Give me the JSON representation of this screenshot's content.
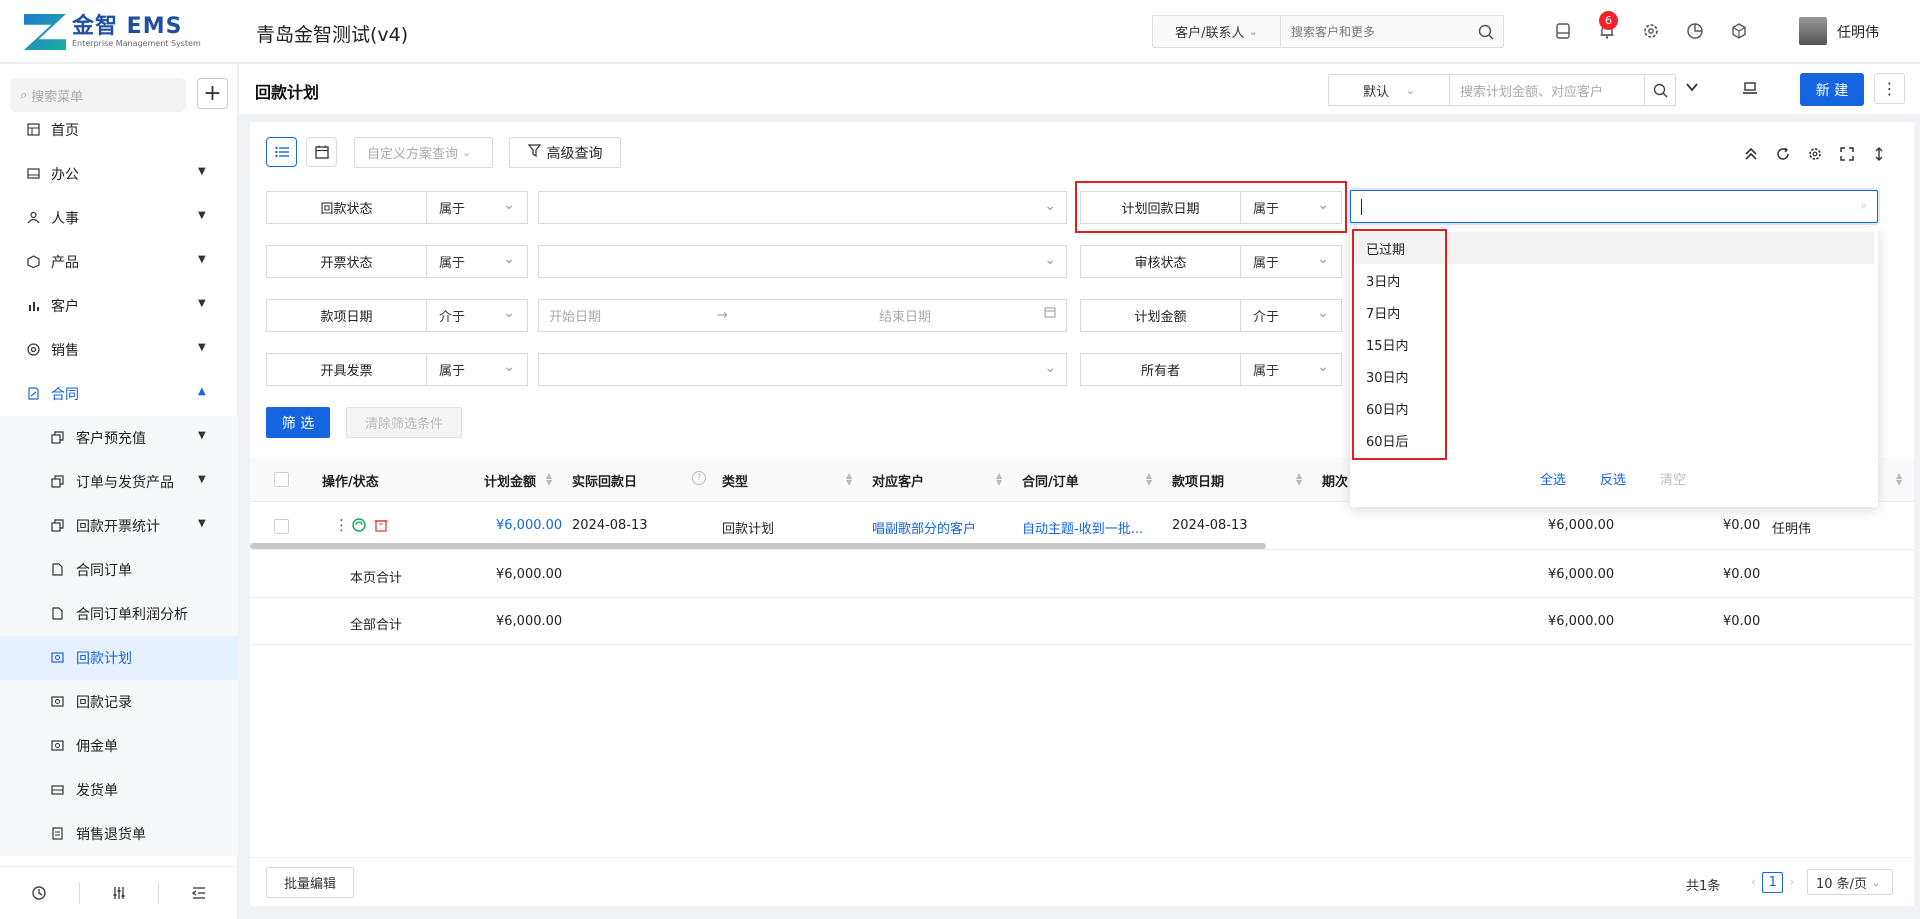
{
  "header": {
    "logo_main": "金智 EMS",
    "logo_sub": "Enterprise Management System",
    "app_title": "青岛金智测试(v4)",
    "search_scope": "客户/联系人",
    "search_placeholder": "搜索客户和更多",
    "notification_count": "6",
    "user_name": "任明伟"
  },
  "sidebar": {
    "search_placeholder": "搜索菜单",
    "add_label": "+",
    "items": [
      {
        "label": "首页",
        "icon": "home-icon"
      },
      {
        "label": "办公",
        "icon": "office-icon"
      },
      {
        "label": "人事",
        "icon": "people-icon"
      },
      {
        "label": "产品",
        "icon": "box-icon"
      },
      {
        "label": "客户",
        "icon": "chart-icon"
      },
      {
        "label": "销售",
        "icon": "target-icon"
      },
      {
        "label": "合同",
        "icon": "contract-icon"
      }
    ],
    "sub_items": [
      {
        "label": "客户预充值"
      },
      {
        "label": "订单与发货产品"
      },
      {
        "label": "回款开票统计"
      },
      {
        "label": "合同订单"
      },
      {
        "label": "合同订单利润分析"
      },
      {
        "label": "回款计划"
      },
      {
        "label": "回款记录"
      },
      {
        "label": "佣金单"
      },
      {
        "label": "发货单"
      },
      {
        "label": "销售退货单"
      }
    ]
  },
  "page": {
    "title": "回款计划",
    "view_select": "默认",
    "search_placeholder": "搜索计划金额、对应客户",
    "new_label": "新 建"
  },
  "filters": {
    "custom_query_placeholder": "自定义方案查询",
    "advanced_label": "高级查询",
    "rows": [
      {
        "label": "回款状态",
        "op": "属于"
      },
      {
        "label": "开票状态",
        "op": "属于"
      },
      {
        "label": "款项日期",
        "op": "介于",
        "start": "开始日期",
        "end": "结束日期"
      },
      {
        "label": "开具发票",
        "op": "属于"
      }
    ],
    "right_rows": [
      {
        "label": "计划回款日期",
        "op": "属于"
      },
      {
        "label": "审核状态",
        "op": "属于"
      },
      {
        "label": "计划金额",
        "op": "介于"
      },
      {
        "label": "所有者",
        "op": "属于"
      }
    ],
    "filter_btn": "筛 选",
    "clear_btn": "清除筛选条件"
  },
  "dropdown": {
    "options": [
      "已过期",
      "3日内",
      "7日内",
      "15日内",
      "30日内",
      "60日内",
      "60日后"
    ],
    "select_all": "全选",
    "invert": "反选",
    "clear": "清空"
  },
  "table": {
    "headers": [
      "操作/状态",
      "计划金额",
      "实际回款日",
      "类型",
      "对应客户",
      "合同/订单",
      "款项日期",
      "期次"
    ],
    "row": {
      "amount": "¥6,000.00",
      "actual_date": "2024-08-13",
      "type": "回款计划",
      "customer": "唱副歌部分的客户",
      "contract": "自动主题-收到一批...",
      "due_date": "2024-08-13",
      "col_a": "¥6,000.00",
      "col_b": "¥0.00",
      "owner": "任明伟"
    },
    "page_total": {
      "label": "本页合计",
      "amount": "¥6,000.00",
      "col_a": "¥6,000.00",
      "col_b": "¥0.00"
    },
    "all_total": {
      "label": "全部合计",
      "amount": "¥6,000.00",
      "col_a": "¥6,000.00",
      "col_b": "¥0.00"
    }
  },
  "footer": {
    "batch_edit": "批量编辑",
    "total": "共1条",
    "page": "1",
    "page_size": "10 条/页"
  }
}
